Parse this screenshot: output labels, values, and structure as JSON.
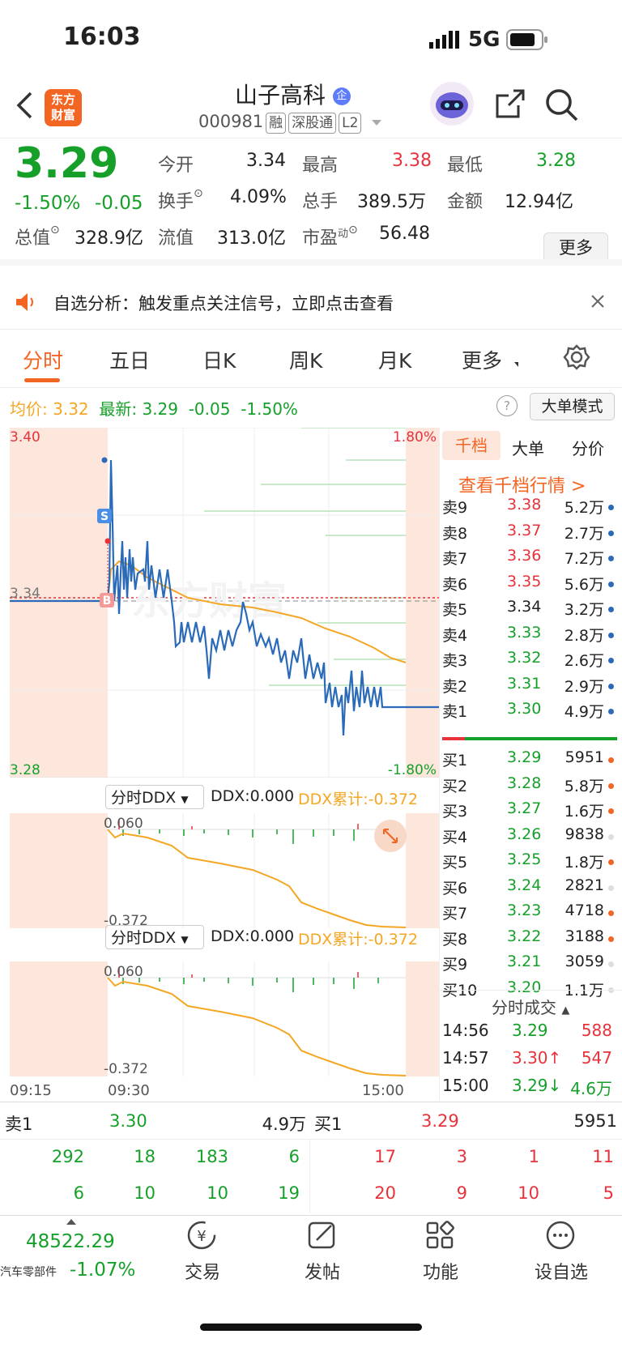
{
  "status_bar": {
    "time": "16:03",
    "network": "5G"
  },
  "header": {
    "logo_line1": "东方",
    "logo_line2": "财富",
    "stock_name": "山子高科",
    "name_badge": "企",
    "code": "000981",
    "tags": [
      "融",
      "深股通",
      "L2"
    ]
  },
  "quote": {
    "price": "3.29",
    "change_pct": "-1.50%",
    "change": "-0.05",
    "open_label": "今开",
    "open": "3.34",
    "high_label": "最高",
    "high": "3.38",
    "low_label": "最低",
    "low": "3.28",
    "turnover_label": "换手",
    "turnover": "4.09%",
    "volume_label": "总手",
    "volume": "389.5万",
    "amount_label": "金额",
    "amount": "12.94亿",
    "mktcap_label": "总值",
    "mktcap": "328.9亿",
    "float_label": "流值",
    "float": "313.0亿",
    "pe_label": "市盈",
    "pe_sup": "动",
    "pe": "56.48",
    "more": "更多"
  },
  "banner": {
    "text": "自选分析：触发重点关注信号，立即点击查看"
  },
  "tabs": [
    "分时",
    "五日",
    "日K",
    "周K",
    "月K",
    "更多"
  ],
  "chart_info": {
    "avg_label": "均价:",
    "avg": "3.32",
    "latest_label": "最新:",
    "latest": "3.29",
    "chg": "-0.05",
    "chg_pct": "-1.50%",
    "mode_btn": "大单模式"
  },
  "chart_labels": {
    "y_top": "3.40",
    "y_mid": "3.34",
    "y_bot": "3.28",
    "pct_top": "1.80%",
    "pct_bot": "-1.80%",
    "marker_s": "S",
    "marker_b": "B",
    "watermark": "东方财富"
  },
  "ddx1": {
    "title": "分时DDX",
    "ddx": "DDX:0.000",
    "cum": "DDX累计:-0.372",
    "top": "0.060",
    "bot": "-0.372"
  },
  "ddx2": {
    "title": "分时DDX",
    "ddx": "DDX:0.000",
    "cum": "DDX累计:-0.372",
    "top": "0.060",
    "bot": "-0.372"
  },
  "time_axis": [
    "09:15",
    "09:30",
    "15:00"
  ],
  "orderbook": {
    "tabs": [
      "千档",
      "大单",
      "分价"
    ],
    "link": "查看千档行情 >",
    "asks": [
      {
        "label": "卖9",
        "price": "3.38",
        "vol": "5.2万"
      },
      {
        "label": "卖8",
        "price": "3.37",
        "vol": "2.7万"
      },
      {
        "label": "卖7",
        "price": "3.36",
        "vol": "7.2万"
      },
      {
        "label": "卖6",
        "price": "3.35",
        "vol": "5.6万"
      },
      {
        "label": "卖5",
        "price": "3.34",
        "vol": "3.2万"
      },
      {
        "label": "卖4",
        "price": "3.33",
        "vol": "2.8万"
      },
      {
        "label": "卖3",
        "price": "3.32",
        "vol": "2.6万"
      },
      {
        "label": "卖2",
        "price": "3.31",
        "vol": "2.9万"
      },
      {
        "label": "卖1",
        "price": "3.30",
        "vol": "4.9万"
      }
    ],
    "bids": [
      {
        "label": "买1",
        "price": "3.29",
        "vol": "5951"
      },
      {
        "label": "买2",
        "price": "3.28",
        "vol": "5.8万"
      },
      {
        "label": "买3",
        "price": "3.27",
        "vol": "1.6万"
      },
      {
        "label": "买4",
        "price": "3.26",
        "vol": "9838"
      },
      {
        "label": "买5",
        "price": "3.25",
        "vol": "1.8万"
      },
      {
        "label": "买6",
        "price": "3.24",
        "vol": "2821"
      },
      {
        "label": "买7",
        "price": "3.23",
        "vol": "4718"
      },
      {
        "label": "买8",
        "price": "3.22",
        "vol": "3188"
      },
      {
        "label": "买9",
        "price": "3.21",
        "vol": "3059"
      },
      {
        "label": "买10",
        "price": "3.20",
        "vol": "1.1万"
      }
    ],
    "trades_title": "分时成交",
    "trades": [
      {
        "time": "14:56",
        "price": "3.29",
        "vol": "588"
      },
      {
        "time": "14:57",
        "price": "3.30↑",
        "vol": "547"
      },
      {
        "time": "15:00",
        "price": "3.29↓",
        "vol": "4.6万"
      }
    ]
  },
  "queue": {
    "sell_label": "卖1",
    "sell_price": "3.30",
    "sell_vol": "4.9万",
    "buy_label": "买1",
    "buy_price": "3.29",
    "buy_vol": "5951",
    "sell_row1": [
      "292",
      "18",
      "183",
      "6"
    ],
    "sell_row2": [
      "6",
      "10",
      "10",
      "19"
    ],
    "buy_row1": [
      "17",
      "3",
      "1",
      "11"
    ],
    "buy_row2": [
      "20",
      "9",
      "10",
      "5"
    ]
  },
  "bottom_nav": {
    "index_value": "48522.29",
    "index_name": "汽车零部件",
    "index_pct": "-1.07%",
    "items": [
      "交易",
      "发帖",
      "功能",
      "设自选"
    ]
  },
  "colors": {
    "up": "#e8323c",
    "down": "#16a02a",
    "avg": "#f5a623",
    "price_line": "#2a6ab8",
    "accent": "#f26522"
  }
}
